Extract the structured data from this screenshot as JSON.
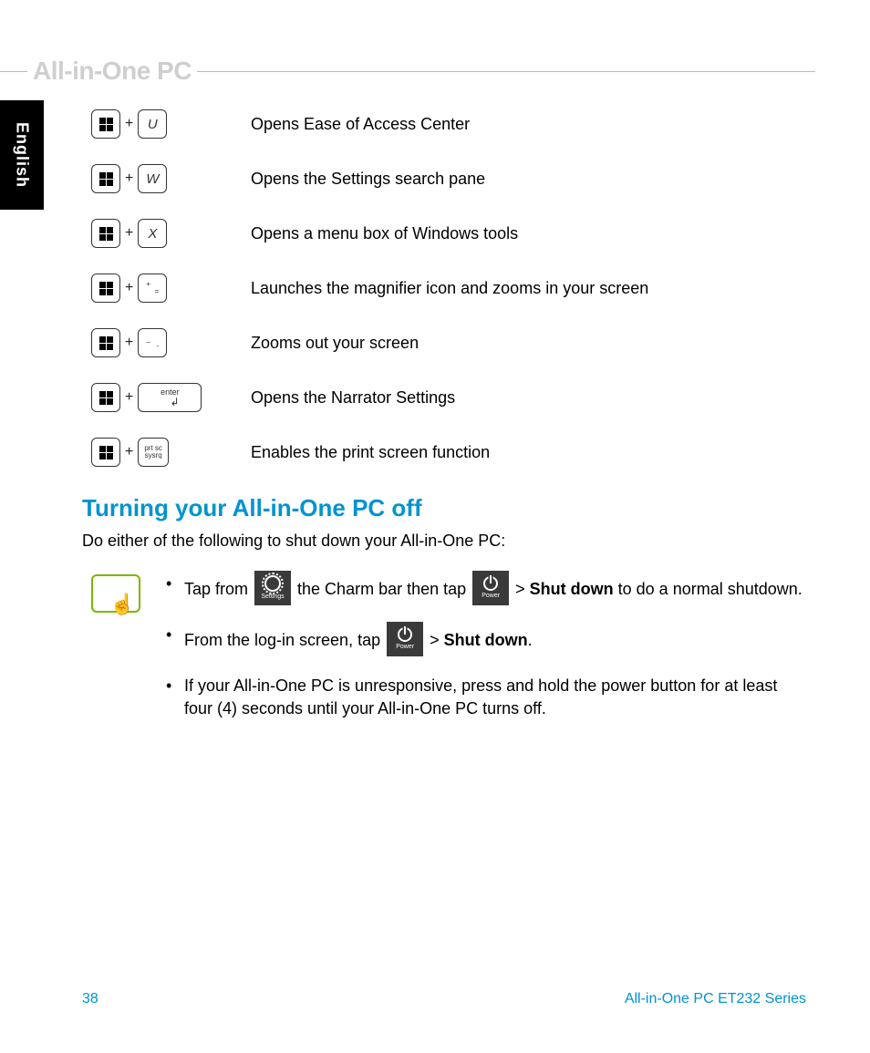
{
  "header_title": "All-in-One PC",
  "language_tab": "English",
  "shortcuts": {
    "s1": {
      "key": "U",
      "desc": "Opens Ease of Access Center"
    },
    "s2": {
      "key": "W",
      "desc": "Opens the Settings search pane"
    },
    "s3": {
      "key": "X",
      "desc": "Opens a menu box of Windows tools"
    },
    "s4": {
      "top": "+",
      "bot": "=",
      "desc": "Launches the magnifier icon and zooms in your screen"
    },
    "s5": {
      "top": "_",
      "bot": "-",
      "desc": "Zooms out your screen"
    },
    "s6": {
      "key": "enter",
      "desc": "Opens the Narrator Settings"
    },
    "s7": {
      "line1": "prt sc",
      "line2": "sysrq",
      "desc": "Enables the print screen function"
    }
  },
  "turn_off": {
    "heading": "Turning your All-in-One PC off",
    "intro": "Do either of the following to shut down your All-in-One PC:",
    "tile_settings": "Settings",
    "tile_power": "Power",
    "b1_a": "Tap  from ",
    "b1_b": " the Charm bar then tap ",
    "b1_c": " > ",
    "b1_bold": "Shut down",
    "b1_d": " to do a normal shutdown.",
    "b2_a": "From the log-in screen, tap ",
    "b2_b": " > ",
    "b2_bold": "Shut down",
    "b2_c": ".",
    "b3": "If your All-in-One PC is unresponsive, press and hold the power button for at least four (4) seconds until your All-in-One PC turns off."
  },
  "footer": {
    "page": "38",
    "model": "All-in-One PC ET232 Series"
  }
}
